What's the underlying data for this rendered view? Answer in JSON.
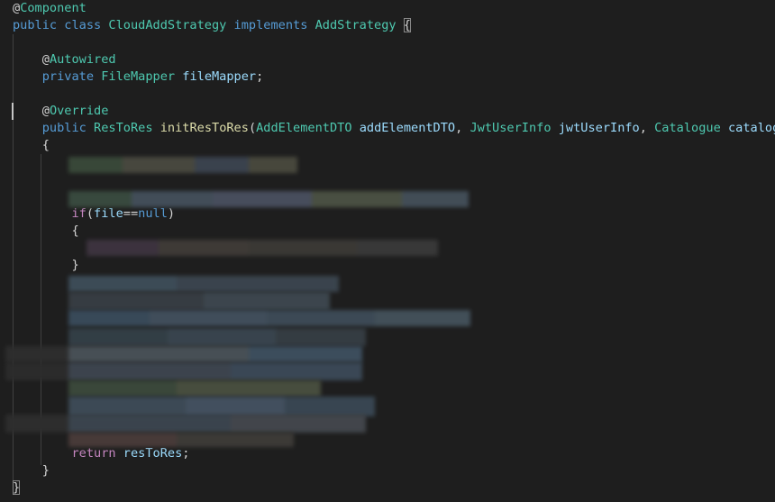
{
  "editor": {
    "colors": {
      "background": "#1e1e1e",
      "annotation": "#4ec9b0",
      "keyword": "#569cd6",
      "type": "#4ec9b0",
      "function": "#dcdcaa",
      "variable": "#9cdcfe",
      "punctuation": "#d4d4d4",
      "control": "#c586c0"
    },
    "lines": [
      {
        "tokens": [
          {
            "t": "@",
            "c": "at"
          },
          {
            "t": "Component",
            "c": "ann"
          }
        ]
      },
      {
        "tokens": [
          {
            "t": "public",
            "c": "kw"
          },
          {
            "t": " ",
            "c": "punc"
          },
          {
            "t": "class",
            "c": "kw"
          },
          {
            "t": " ",
            "c": "punc"
          },
          {
            "t": "CloudAddStrategy",
            "c": "type"
          },
          {
            "t": " ",
            "c": "punc"
          },
          {
            "t": "implements",
            "c": "kw"
          },
          {
            "t": " ",
            "c": "punc"
          },
          {
            "t": "AddStrategy",
            "c": "type"
          },
          {
            "t": " ",
            "c": "punc"
          },
          {
            "t": "{",
            "c": "punc",
            "box": true
          }
        ]
      },
      {
        "tokens": []
      },
      {
        "tokens": [
          {
            "t": "    ",
            "c": "punc"
          },
          {
            "t": "@",
            "c": "at"
          },
          {
            "t": "Autowired",
            "c": "ann"
          }
        ]
      },
      {
        "tokens": [
          {
            "t": "    ",
            "c": "punc"
          },
          {
            "t": "private",
            "c": "kw"
          },
          {
            "t": " ",
            "c": "punc"
          },
          {
            "t": "FileMapper",
            "c": "type"
          },
          {
            "t": " ",
            "c": "punc"
          },
          {
            "t": "fileMapper",
            "c": "var"
          },
          {
            "t": ";",
            "c": "punc"
          }
        ]
      },
      {
        "tokens": []
      },
      {
        "tokens": [
          {
            "t": "    ",
            "c": "punc"
          },
          {
            "t": "@",
            "c": "at"
          },
          {
            "t": "Override",
            "c": "ann"
          }
        ]
      },
      {
        "tokens": [
          {
            "t": "    ",
            "c": "punc"
          },
          {
            "t": "public",
            "c": "kw"
          },
          {
            "t": " ",
            "c": "punc"
          },
          {
            "t": "ResToRes",
            "c": "type"
          },
          {
            "t": " ",
            "c": "punc"
          },
          {
            "t": "initResToRes",
            "c": "fn"
          },
          {
            "t": "(",
            "c": "punc"
          },
          {
            "t": "AddElementDTO",
            "c": "type"
          },
          {
            "t": " ",
            "c": "punc"
          },
          {
            "t": "addElementDTO",
            "c": "var"
          },
          {
            "t": ", ",
            "c": "punc"
          },
          {
            "t": "JwtUserInfo",
            "c": "type"
          },
          {
            "t": " ",
            "c": "punc"
          },
          {
            "t": "jwtUserInfo",
            "c": "var"
          },
          {
            "t": ", ",
            "c": "punc"
          },
          {
            "t": "Catalogue",
            "c": "type"
          },
          {
            "t": " ",
            "c": "punc"
          },
          {
            "t": "catalogue",
            "c": "var"
          },
          {
            "t": ")",
            "c": "punc"
          }
        ]
      },
      {
        "tokens": [
          {
            "t": "    ",
            "c": "punc"
          },
          {
            "t": "{",
            "c": "punc"
          }
        ]
      },
      {
        "tokens": []
      },
      {
        "tokens": []
      },
      {
        "tokens": []
      },
      {
        "tokens": [
          {
            "t": "        ",
            "c": "punc"
          },
          {
            "t": "if",
            "c": "ctl"
          },
          {
            "t": "(",
            "c": "punc"
          },
          {
            "t": "file",
            "c": "var"
          },
          {
            "t": "==",
            "c": "punc"
          },
          {
            "t": "null",
            "c": "kw"
          },
          {
            "t": ")",
            "c": "punc"
          }
        ]
      },
      {
        "tokens": [
          {
            "t": "        ",
            "c": "punc"
          },
          {
            "t": "{",
            "c": "punc"
          }
        ]
      },
      {
        "tokens": []
      },
      {
        "tokens": [
          {
            "t": "        ",
            "c": "punc"
          },
          {
            "t": "}",
            "c": "punc"
          }
        ]
      },
      {
        "tokens": []
      },
      {
        "tokens": []
      },
      {
        "tokens": []
      },
      {
        "tokens": []
      },
      {
        "tokens": []
      },
      {
        "tokens": []
      },
      {
        "tokens": []
      },
      {
        "tokens": []
      },
      {
        "tokens": []
      },
      {
        "tokens": []
      },
      {
        "tokens": [
          {
            "t": "        ",
            "c": "punc"
          },
          {
            "t": "return",
            "c": "ctl"
          },
          {
            "t": " ",
            "c": "punc"
          },
          {
            "t": "resToRes",
            "c": "var"
          },
          {
            "t": ";",
            "c": "punc"
          }
        ]
      },
      {
        "tokens": [
          {
            "t": "    ",
            "c": "punc"
          },
          {
            "t": "}",
            "c": "punc"
          }
        ]
      },
      {
        "tokens": [
          {
            "t": "}",
            "c": "punc",
            "box": true
          }
        ]
      }
    ]
  }
}
